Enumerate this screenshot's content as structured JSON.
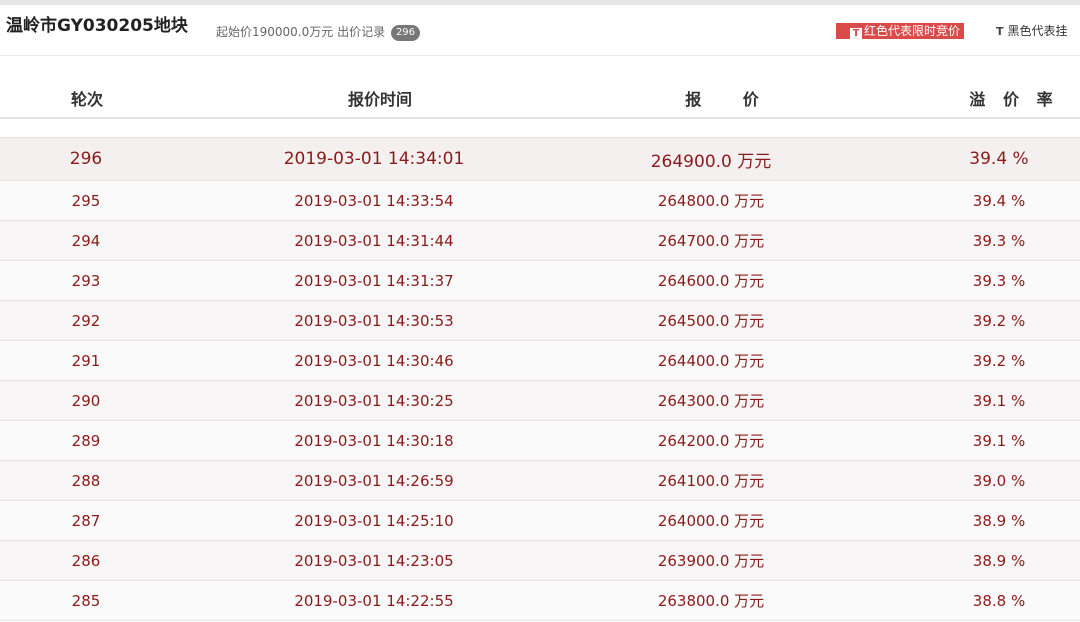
{
  "header": {
    "title": "温岭市GY030205地块",
    "start_price_text": "起始价190000.0万元",
    "bid_record_label": "出价记录",
    "bid_count": "296",
    "legend_red": "红色代表限时竞价",
    "legend_red_icon": "T",
    "legend_black": "黑色代表挂",
    "legend_black_icon": "T"
  },
  "table": {
    "columns": {
      "round": "轮次",
      "time": "报价时间",
      "price": "报 价",
      "rate": "溢 价 率"
    },
    "rows": [
      {
        "round": "296",
        "time": "2019-03-01 14:34:01",
        "price": "264900.0 万元",
        "rate": "39.4 %"
      },
      {
        "round": "295",
        "time": "2019-03-01 14:33:54",
        "price": "264800.0 万元",
        "rate": "39.4 %"
      },
      {
        "round": "294",
        "time": "2019-03-01 14:31:44",
        "price": "264700.0 万元",
        "rate": "39.3 %"
      },
      {
        "round": "293",
        "time": "2019-03-01 14:31:37",
        "price": "264600.0 万元",
        "rate": "39.3 %"
      },
      {
        "round": "292",
        "time": "2019-03-01 14:30:53",
        "price": "264500.0 万元",
        "rate": "39.2 %"
      },
      {
        "round": "291",
        "time": "2019-03-01 14:30:46",
        "price": "264400.0 万元",
        "rate": "39.2 %"
      },
      {
        "round": "290",
        "time": "2019-03-01 14:30:25",
        "price": "264300.0 万元",
        "rate": "39.1 %"
      },
      {
        "round": "289",
        "time": "2019-03-01 14:30:18",
        "price": "264200.0 万元",
        "rate": "39.1 %"
      },
      {
        "round": "288",
        "time": "2019-03-01 14:26:59",
        "price": "264100.0 万元",
        "rate": "39.0 %"
      },
      {
        "round": "287",
        "time": "2019-03-01 14:25:10",
        "price": "264000.0 万元",
        "rate": "38.9 %"
      },
      {
        "round": "286",
        "time": "2019-03-01 14:23:05",
        "price": "263900.0 万元",
        "rate": "38.9 %"
      },
      {
        "round": "285",
        "time": "2019-03-01 14:22:55",
        "price": "263800.0 万元",
        "rate": "38.8 %"
      }
    ]
  }
}
